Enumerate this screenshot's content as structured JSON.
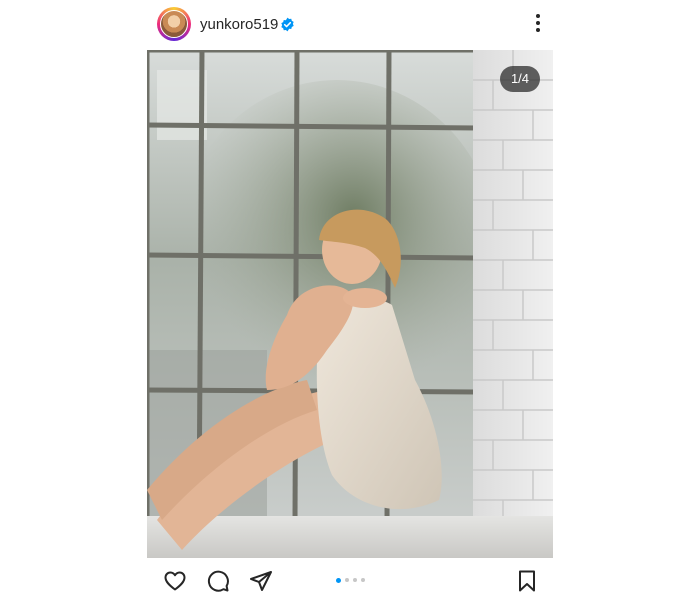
{
  "post": {
    "username": "yunkoro519",
    "verified": true,
    "slide_counter": "1/4",
    "slide_current": 1,
    "slide_total": 4,
    "photo_description_icon": "photo-woman-by-window"
  },
  "colors": {
    "accent": "#0095f6",
    "text": "#262626",
    "dot_inactive": "#c7c7c7"
  },
  "actions": [
    "heart-icon",
    "comment-icon",
    "share-icon",
    "bookmark-icon"
  ]
}
